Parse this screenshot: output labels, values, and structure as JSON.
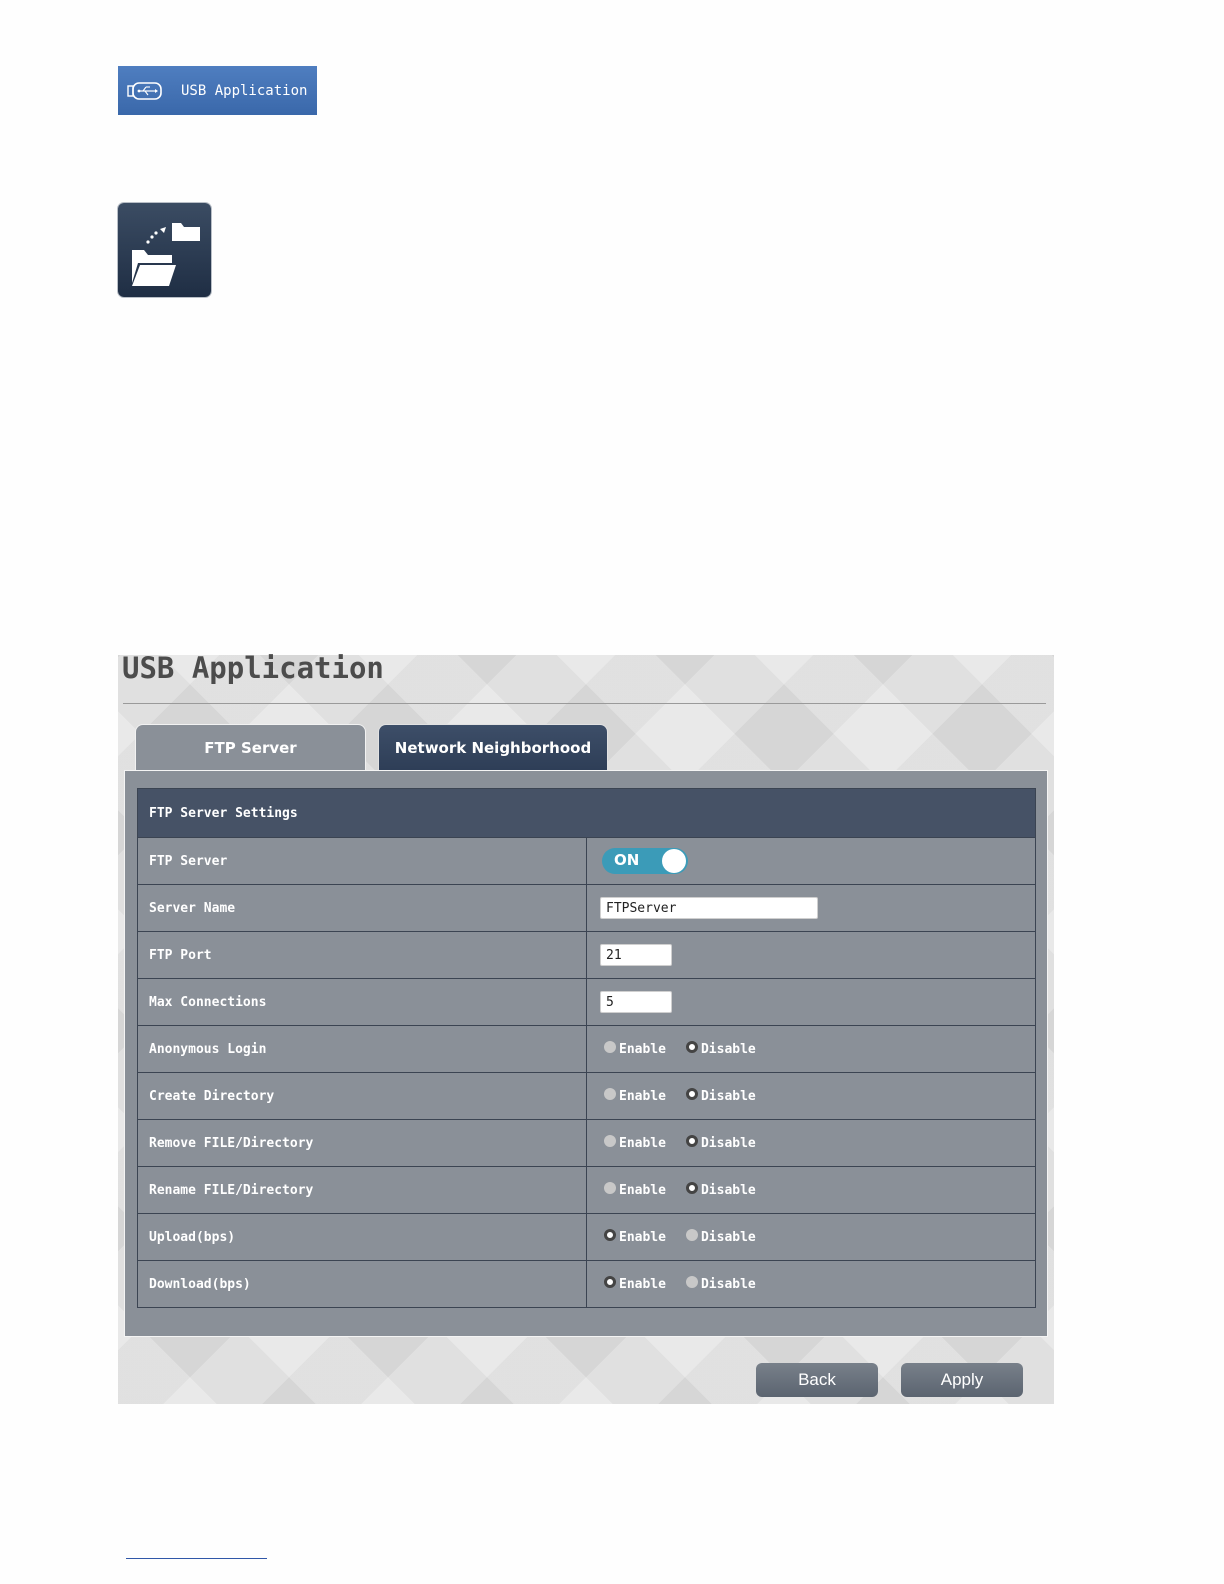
{
  "menu": {
    "label": "USB Application",
    "icon": "usb-icon"
  },
  "folder_tile": {
    "icon": "folder-share-icon"
  },
  "panel": {
    "title": "USB Application",
    "tabs": [
      {
        "label": "FTP Server",
        "active": true
      },
      {
        "label": "Network Neighborhood",
        "active": false
      }
    ],
    "section_header": "FTP Server Settings",
    "rows": {
      "ftp_server": {
        "label": "FTP Server",
        "toggle": "ON"
      },
      "server_name": {
        "label": "Server Name",
        "value": "FTPServer"
      },
      "ftp_port": {
        "label": "FTP Port",
        "value": "21"
      },
      "max_connections": {
        "label": "Max Connections",
        "value": "5"
      }
    },
    "radio_rows": [
      {
        "label": "Anonymous Login",
        "enable": "Enable",
        "disable": "Disable",
        "selected": "Disable"
      },
      {
        "label": "Create Directory",
        "enable": "Enable",
        "disable": "Disable",
        "selected": "Disable"
      },
      {
        "label": "Remove FILE/Directory",
        "enable": "Enable",
        "disable": "Disable",
        "selected": "Disable"
      },
      {
        "label": "Rename FILE/Directory",
        "enable": "Enable",
        "disable": "Disable",
        "selected": "Disable"
      },
      {
        "label": "Upload(bps)",
        "enable": "Enable",
        "disable": "Disable",
        "selected": "Enable"
      },
      {
        "label": "Download(bps)",
        "enable": "Enable",
        "disable": "Disable",
        "selected": "Enable"
      }
    ],
    "buttons": {
      "back": "Back",
      "apply": "Apply"
    }
  },
  "colors": {
    "accent_toggle": "#3b9bb8",
    "menu_blue": "#4a78ba",
    "header_dark": "#465266",
    "panel_gray": "#8a9098"
  }
}
